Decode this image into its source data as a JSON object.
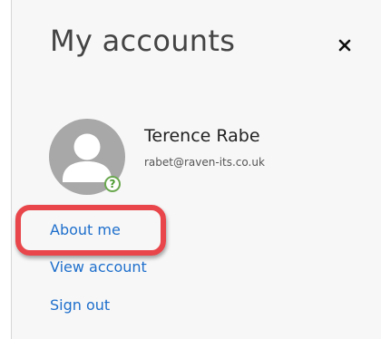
{
  "header": {
    "title": "My accounts",
    "close_icon": "close-icon"
  },
  "user": {
    "name": "Terence Rabe",
    "email": "rabet@raven-its.co.uk",
    "avatar_icon": "person-silhouette-icon",
    "status_glyph": "?",
    "status_color": "#6aa84f"
  },
  "links": {
    "about_me": "About me",
    "view_account": "View account",
    "sign_out": "Sign out"
  },
  "annotation": {
    "highlight_color": "#e8464a"
  },
  "colors": {
    "link": "#1e6fcc",
    "panel_bg": "#f7f7f7"
  }
}
